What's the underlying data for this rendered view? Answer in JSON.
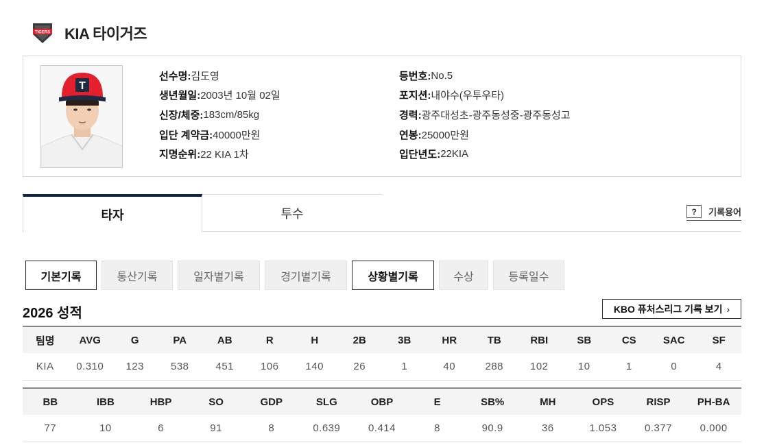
{
  "team": {
    "name": "KIA 타이거즈",
    "logo_text": "TIGERS"
  },
  "player": {
    "left": [
      {
        "label": "선수명:",
        "value": " 김도영"
      },
      {
        "label": "생년월일:",
        "value": " 2003년 10월 02일"
      },
      {
        "label": "신장/체중:",
        "value": " 183cm/85kg"
      },
      {
        "label": "입단 계약금:",
        "value": " 40000만원"
      },
      {
        "label": "지명순위:",
        "value": " 22 KIA 1차"
      }
    ],
    "right": [
      {
        "label": "등번호:",
        "value": " No.5"
      },
      {
        "label": "포지션:",
        "value": " 내야수(우투우타)"
      },
      {
        "label": "경력:",
        "value": " 광주대성초-광주동성중-광주동성고"
      },
      {
        "label": "연봉:",
        "value": " 25000만원"
      },
      {
        "label": "입단년도:",
        "value": " 22KIA"
      }
    ],
    "cap_letter": "T"
  },
  "tabs": {
    "batter": "타자",
    "pitcher": "투수",
    "glossary_icon": "?",
    "glossary": "기록용어"
  },
  "sub_tabs": [
    "기본기록",
    "통산기록",
    "일자별기록",
    "경기별기록",
    "상황별기록",
    "수상",
    "등록일수"
  ],
  "season": {
    "title": "2026 성적",
    "futures_button": "KBO 퓨처스리그 기록 보기",
    "chevron": "›"
  },
  "table1": {
    "headers": [
      "팀명",
      "AVG",
      "G",
      "PA",
      "AB",
      "R",
      "H",
      "2B",
      "3B",
      "HR",
      "TB",
      "RBI",
      "SB",
      "CS",
      "SAC",
      "SF"
    ],
    "row": [
      "KIA",
      "0.310",
      "123",
      "538",
      "451",
      "106",
      "140",
      "26",
      "1",
      "40",
      "288",
      "102",
      "10",
      "1",
      "0",
      "4"
    ]
  },
  "table2": {
    "headers": [
      "BB",
      "IBB",
      "HBP",
      "SO",
      "GDP",
      "SLG",
      "OBP",
      "E",
      "SB%",
      "MH",
      "OPS",
      "RISP",
      "PH-BA"
    ],
    "row": [
      "77",
      "10",
      "6",
      "91",
      "8",
      "0.639",
      "0.414",
      "8",
      "90.9",
      "36",
      "1.053",
      "0.377",
      "0.000"
    ]
  },
  "colors": {
    "navy": "#0b2254",
    "cap_red": "#e4202f"
  }
}
